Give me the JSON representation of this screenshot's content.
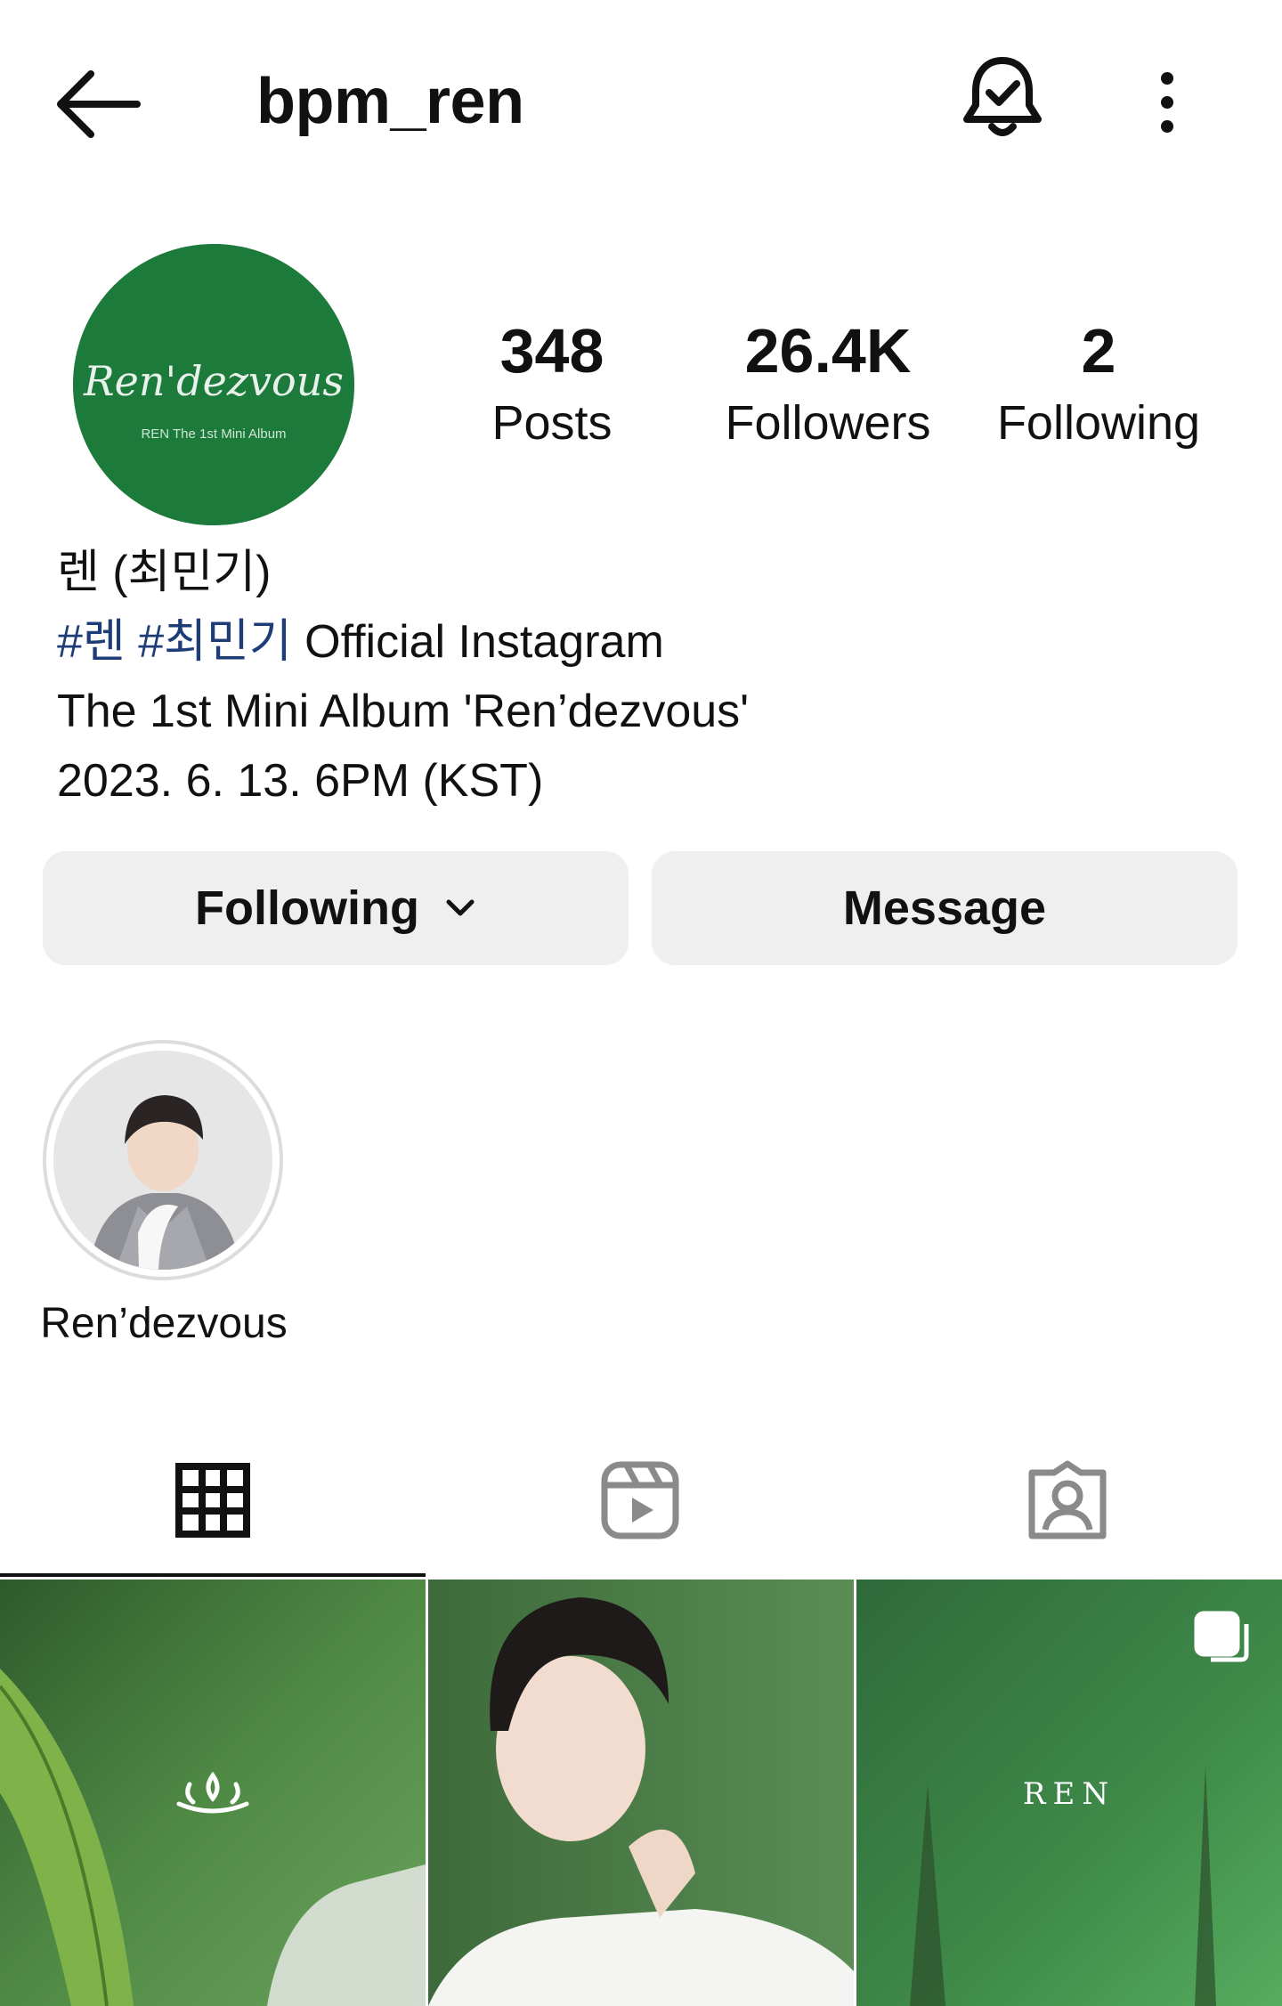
{
  "header": {
    "username": "bpm_ren",
    "icons": {
      "back": "arrow-left-icon",
      "notifications": "bell-check-icon",
      "more": "vertical-dots-icon"
    }
  },
  "profile": {
    "avatar_logo_text": "Ren'dezvous",
    "avatar_sub_text": "REN The 1st Mini Album",
    "stats": [
      {
        "value": "348",
        "label": "Posts"
      },
      {
        "value": "26.4K",
        "label": "Followers"
      },
      {
        "value": "2",
        "label": "Following"
      }
    ],
    "name": "렌 (최민기)",
    "bio": {
      "hashtag_1": "#렌",
      "hashtag_2": "#최민기",
      "line2_rest": " Official Instagram",
      "line3": "The 1st Mini Album 'Ren’dezvous'",
      "line4": "2023. 6. 13. 6PM (KST)"
    }
  },
  "actions": {
    "following_label": "Following",
    "message_label": "Message"
  },
  "highlights": [
    {
      "label": "Ren’dezvous"
    }
  ],
  "tabs": [
    {
      "name": "posts-grid",
      "icon": "grid-icon",
      "active": true
    },
    {
      "name": "reels",
      "icon": "reels-icon",
      "active": false
    },
    {
      "name": "tagged",
      "icon": "tagged-person-icon",
      "active": false
    }
  ],
  "posts": [
    {
      "overlay_icon": "crown-logo-icon"
    },
    {
      "overlay_icon": ""
    },
    {
      "overlay_text": "REN",
      "overlay_icon": "carousel-icon"
    }
  ],
  "colors": {
    "avatar_green": "#1c7a3b",
    "hashtag_blue": "#1e3d78",
    "button_gray": "#efefef"
  }
}
